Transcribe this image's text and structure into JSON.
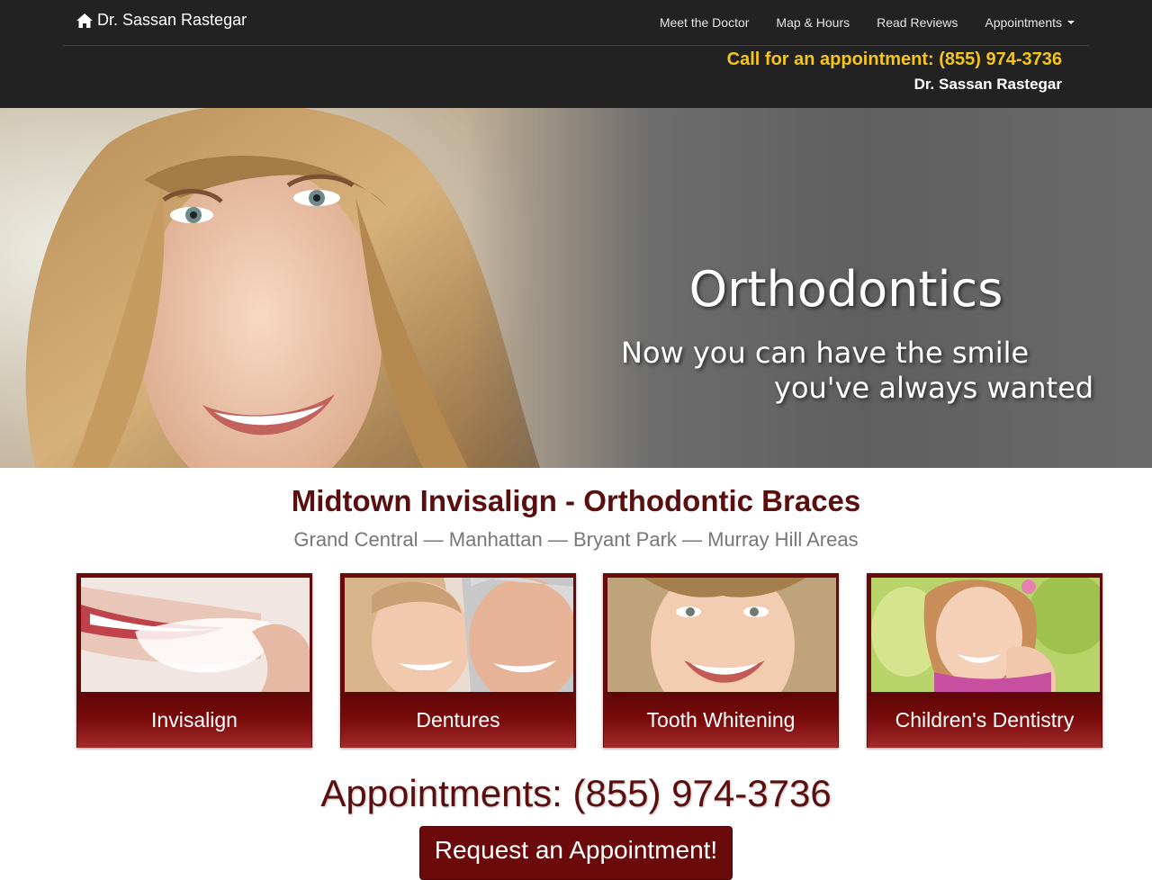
{
  "header": {
    "brand": "Dr. Sassan Rastegar",
    "nav": [
      {
        "label": "Meet the Doctor"
      },
      {
        "label": "Map & Hours"
      },
      {
        "label": "Read Reviews"
      },
      {
        "label": "Appointments"
      }
    ],
    "call_line": "Call for an appointment: (855) 974-3736",
    "doctor_name": "Dr. Sassan Rastegar"
  },
  "hero": {
    "title": "Orthodontics",
    "subtitle_line1": "Now you can have the smile",
    "subtitle_line2": "you've always wanted"
  },
  "main": {
    "title": "Midtown Invisalign - Orthodontic Braces",
    "subtitle": "Grand Central — Manhattan — Bryant Park — Murray Hill Areas"
  },
  "cards": [
    {
      "label": "Invisalign"
    },
    {
      "label": "Dentures"
    },
    {
      "label": "Tooth Whitening"
    },
    {
      "label": "Children's Dentistry"
    }
  ],
  "appointments": {
    "phone_line": "Appointments: (855) 974-3736",
    "button": "Request an Appointment!"
  },
  "colors": {
    "header_bg": "#222222",
    "accent_gold": "#f5c518",
    "maroon": "#5a0e0e",
    "card_red": "#6b0a0a"
  }
}
